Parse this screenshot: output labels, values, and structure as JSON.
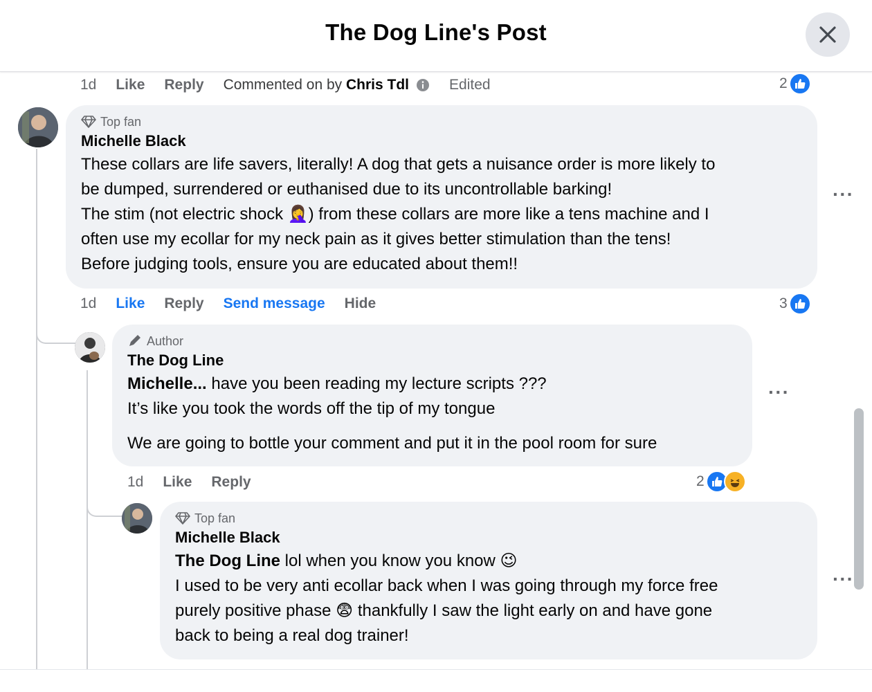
{
  "header": {
    "title": "The Dog Line's Post"
  },
  "prev_comment_actions": {
    "time": "1d",
    "like": "Like",
    "reply": "Reply",
    "commented_on": "Commented on by",
    "commenter": "Chris Tdl",
    "edited": "Edited",
    "reaction_count": "2"
  },
  "comment1": {
    "badge": "Top fan",
    "author": "Michelle Black",
    "lines": [
      "These collars are life savers, literally! A dog that gets a nuisance order is more likely to",
      "be dumped, surrendered or euthanised due to its uncontrollable barking!",
      "The stim (not electric shock 🤦‍♀️) from these collars are more like a tens machine and I",
      "often use my ecollar for my neck pain as it gives better stimulation than the tens!",
      "Before judging tools, ensure you are educated about them!!"
    ],
    "actions": {
      "time": "1d",
      "like": "Like",
      "reply": "Reply",
      "send_message": "Send message",
      "hide": "Hide"
    },
    "reaction_count": "3"
  },
  "reply1": {
    "badge": "Author",
    "author": "The Dog Line",
    "mention": "Michelle...",
    "line1_rest": " have you been reading my lecture scripts ???",
    "line2": "It’s like you took the words off the tip of my tongue",
    "line3": "We are going to bottle your comment and put it in the pool room for sure",
    "actions": {
      "time": "1d",
      "like": "Like",
      "reply": "Reply"
    },
    "reaction_count": "2"
  },
  "reply2": {
    "badge": "Top fan",
    "author": "Michelle Black",
    "mention": "The Dog Line",
    "line1_rest": " lol when you know you know 😉",
    "lines": [
      "I used to be very anti ecollar back when I was going through my force free",
      "purely positive phase 😨 thankfully I saw the light early on and have gone",
      "back to being a real dog trainer!"
    ]
  },
  "colors": {
    "accent": "#1877f2",
    "bubble": "#f0f2f5",
    "muted": "#65676b"
  }
}
